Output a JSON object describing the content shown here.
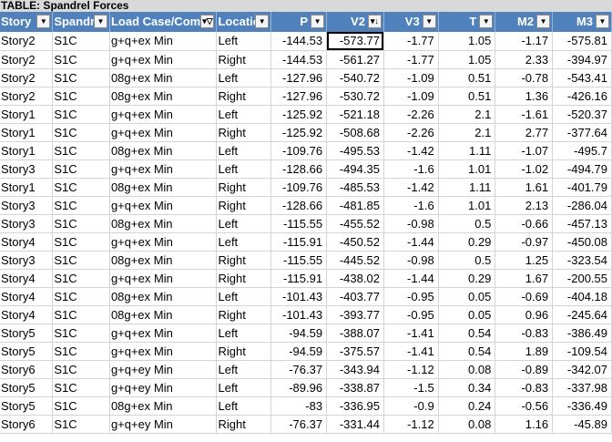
{
  "table_title": "TABLE:  Spandrel Forces",
  "columns": [
    {
      "label": "Story",
      "align": "txt",
      "filter": "dropdown"
    },
    {
      "label": "Spandrel",
      "align": "txt",
      "filter": "dropdown"
    },
    {
      "label": "Load Case/Combo",
      "align": "txt",
      "filter": "filtered"
    },
    {
      "label": "Location",
      "align": "txt",
      "filter": "dropdown"
    },
    {
      "label": "P",
      "align": "num",
      "filter": "dropdown"
    },
    {
      "label": "V2",
      "align": "num",
      "filter": "sorted"
    },
    {
      "label": "V3",
      "align": "num",
      "filter": "dropdown"
    },
    {
      "label": "T",
      "align": "num",
      "filter": "dropdown"
    },
    {
      "label": "M2",
      "align": "num",
      "filter": "dropdown"
    },
    {
      "label": "M3",
      "align": "num",
      "filter": "dropdown"
    }
  ],
  "icons": {
    "dropdown": "dropdown-arrow-icon",
    "filtered": "filter-funnel-icon",
    "sorted": "sort-descending-icon"
  },
  "selected_cell": {
    "row": 0,
    "col": 5
  },
  "rows": [
    [
      "Story2",
      "S1C",
      "g+q+ex Min",
      "Left",
      "-144.53",
      "-573.77",
      "-1.77",
      "1.05",
      "-1.17",
      "-575.81"
    ],
    [
      "Story2",
      "S1C",
      "g+q+ex Min",
      "Right",
      "-144.53",
      "-561.27",
      "-1.77",
      "1.05",
      "2.33",
      "-394.97"
    ],
    [
      "Story2",
      "S1C",
      "08g+ex Min",
      "Left",
      "-127.96",
      "-540.72",
      "-1.09",
      "0.51",
      "-0.78",
      "-543.41"
    ],
    [
      "Story2",
      "S1C",
      "08g+ex Min",
      "Right",
      "-127.96",
      "-530.72",
      "-1.09",
      "0.51",
      "1.36",
      "-426.16"
    ],
    [
      "Story1",
      "S1C",
      "g+q+ex Min",
      "Left",
      "-125.92",
      "-521.18",
      "-2.26",
      "2.1",
      "-1.61",
      "-520.37"
    ],
    [
      "Story1",
      "S1C",
      "g+q+ex Min",
      "Right",
      "-125.92",
      "-508.68",
      "-2.26",
      "2.1",
      "2.77",
      "-377.64"
    ],
    [
      "Story1",
      "S1C",
      "08g+ex Min",
      "Left",
      "-109.76",
      "-495.53",
      "-1.42",
      "1.11",
      "-1.07",
      "-495.7"
    ],
    [
      "Story3",
      "S1C",
      "g+q+ex Min",
      "Left",
      "-128.66",
      "-494.35",
      "-1.6",
      "1.01",
      "-1.02",
      "-494.79"
    ],
    [
      "Story1",
      "S1C",
      "08g+ex Min",
      "Right",
      "-109.76",
      "-485.53",
      "-1.42",
      "1.11",
      "1.61",
      "-401.79"
    ],
    [
      "Story3",
      "S1C",
      "g+q+ex Min",
      "Right",
      "-128.66",
      "-481.85",
      "-1.6",
      "1.01",
      "2.13",
      "-286.04"
    ],
    [
      "Story3",
      "S1C",
      "08g+ex Min",
      "Left",
      "-115.55",
      "-455.52",
      "-0.98",
      "0.5",
      "-0.66",
      "-457.13"
    ],
    [
      "Story4",
      "S1C",
      "g+q+ex Min",
      "Left",
      "-115.91",
      "-450.52",
      "-1.44",
      "0.29",
      "-0.97",
      "-450.08"
    ],
    [
      "Story3",
      "S1C",
      "08g+ex Min",
      "Right",
      "-115.55",
      "-445.52",
      "-0.98",
      "0.5",
      "1.25",
      "-323.54"
    ],
    [
      "Story4",
      "S1C",
      "g+q+ex Min",
      "Right",
      "-115.91",
      "-438.02",
      "-1.44",
      "0.29",
      "1.67",
      "-200.55"
    ],
    [
      "Story4",
      "S1C",
      "08g+ex Min",
      "Left",
      "-101.43",
      "-403.77",
      "-0.95",
      "0.05",
      "-0.69",
      "-404.18"
    ],
    [
      "Story4",
      "S1C",
      "08g+ex Min",
      "Right",
      "-101.43",
      "-393.77",
      "-0.95",
      "0.05",
      "0.96",
      "-245.64"
    ],
    [
      "Story5",
      "S1C",
      "g+q+ex Min",
      "Left",
      "-94.59",
      "-388.07",
      "-1.41",
      "0.54",
      "-0.83",
      "-386.49"
    ],
    [
      "Story5",
      "S1C",
      "g+q+ex Min",
      "Right",
      "-94.59",
      "-375.57",
      "-1.41",
      "0.54",
      "1.89",
      "-109.54"
    ],
    [
      "Story6",
      "S1C",
      "g+q+ey Min",
      "Left",
      "-76.37",
      "-343.94",
      "-1.12",
      "0.08",
      "-0.89",
      "-342.07"
    ],
    [
      "Story5",
      "S1C",
      "g+q+ey Min",
      "Left",
      "-89.96",
      "-338.87",
      "-1.5",
      "0.34",
      "-0.83",
      "-337.98"
    ],
    [
      "Story5",
      "S1C",
      "08g+ex Min",
      "Left",
      "-83",
      "-336.95",
      "-0.9",
      "0.24",
      "-0.56",
      "-336.49"
    ],
    [
      "Story6",
      "S1C",
      "g+q+ey Min",
      "Right",
      "-76.37",
      "-331.44",
      "-1.12",
      "0.08",
      "1.16",
      "-45.89"
    ]
  ]
}
